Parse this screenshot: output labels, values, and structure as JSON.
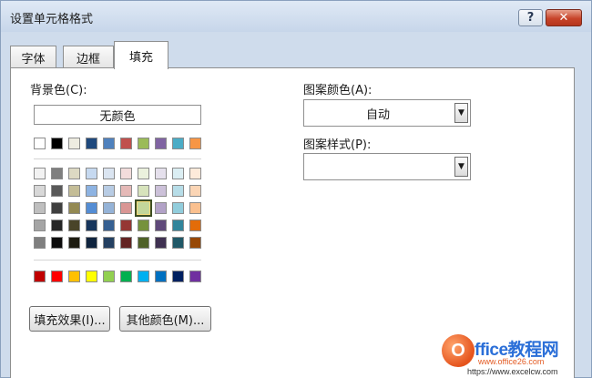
{
  "window": {
    "title": "设置单元格格式"
  },
  "titlebar": {
    "help_label": "?",
    "close_label": "✕"
  },
  "tabs": [
    {
      "label": "字体",
      "active": false
    },
    {
      "label": "边框",
      "active": false
    },
    {
      "label": "填充",
      "active": true
    }
  ],
  "background": {
    "label": "背景色(C):",
    "no_color_label": "无颜色",
    "selected_swatch": "#c3d69b",
    "theme_row": [
      "#ffffff",
      "#000000",
      "#eeece1",
      "#1f497d",
      "#4f81bd",
      "#c0504d",
      "#9bbb59",
      "#8064a2",
      "#4bacc6",
      "#f79646"
    ],
    "tint_rows": [
      [
        "#f2f2f2",
        "#7f7f7f",
        "#ddd9c3",
        "#c6d9f0",
        "#dbe5f1",
        "#f2dcdb",
        "#ebf1dd",
        "#e5e0ec",
        "#dbeef3",
        "#fdeada"
      ],
      [
        "#d8d8d8",
        "#595959",
        "#c4bd97",
        "#8db3e2",
        "#b8cce4",
        "#e5b9b7",
        "#d7e3bc",
        "#ccc1d9",
        "#b7dde8",
        "#fbd5b5"
      ],
      [
        "#bfbfbf",
        "#3f3f3f",
        "#938953",
        "#548dd4",
        "#95b3d7",
        "#d99694",
        "#c3d69b",
        "#b2a2c7",
        "#92cddc",
        "#fac08f"
      ],
      [
        "#a5a5a5",
        "#262626",
        "#494429",
        "#17365d",
        "#366092",
        "#953734",
        "#76923c",
        "#5f497a",
        "#31859b",
        "#e36c09"
      ],
      [
        "#7f7f7f",
        "#0c0c0c",
        "#1d1b10",
        "#0f243e",
        "#244061",
        "#632423",
        "#4f6128",
        "#3f3151",
        "#205867",
        "#974806"
      ]
    ],
    "standard_row": [
      "#c00000",
      "#ff0000",
      "#ffc000",
      "#ffff00",
      "#92d050",
      "#00b050",
      "#00b0f0",
      "#0070c0",
      "#002060",
      "#7030a0"
    ],
    "fill_effects_label": "填充效果(I)...",
    "more_colors_label": "其他颜色(M)..."
  },
  "pattern": {
    "color_label": "图案颜色(A):",
    "color_value": "自动",
    "style_label": "图案样式(P):",
    "style_value": ""
  },
  "watermark": {
    "logo_letter": "O",
    "main_text": "ffice教程网",
    "url1": "www.office26.com",
    "url2": "https://www.excelcw.com"
  }
}
